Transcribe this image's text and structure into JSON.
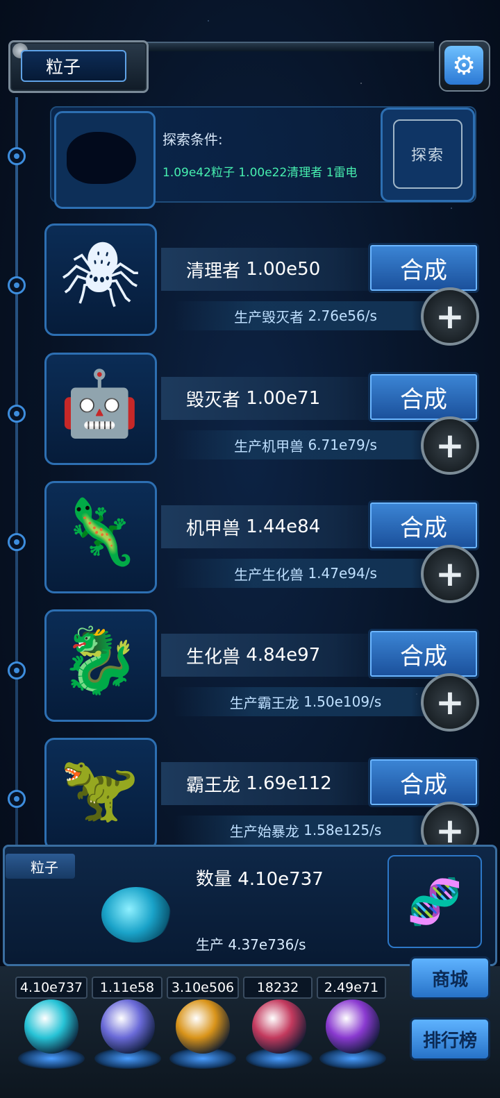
{
  "header": {
    "title": "粒子",
    "settings_icon": "gear-icon"
  },
  "explore": {
    "label": "探索条件:",
    "condition": "1.09e42粒子 1.00e22清理者 1雷电",
    "button_label": "探索",
    "button_icon": "fingerprint-icon"
  },
  "creatures": [
    {
      "name": "清理者",
      "amount": "1.00e50",
      "produces": "生产毁灭者",
      "rate": "2.76e56/s",
      "synth": "合成"
    },
    {
      "name": "毁灭者",
      "amount": "1.00e71",
      "produces": "生产机甲兽",
      "rate": "6.71e79/s",
      "synth": "合成"
    },
    {
      "name": "机甲兽",
      "amount": "1.44e84",
      "produces": "生产生化兽",
      "rate": "1.47e94/s",
      "synth": "合成"
    },
    {
      "name": "生化兽",
      "amount": "4.84e97",
      "produces": "生产霸王龙",
      "rate": "1.50e109/s",
      "synth": "合成"
    },
    {
      "name": "霸王龙",
      "amount": "1.69e112",
      "produces": "生产始暴龙",
      "rate": "1.58e125/s",
      "synth": "合成"
    }
  ],
  "particle_panel": {
    "tag": "粒子",
    "count_label": "数量",
    "count": "4.10e737",
    "prod_label": "生产",
    "prod": "4.37e736/s"
  },
  "resources": [
    {
      "value": "4.10e737",
      "icon": "particle-orb-icon",
      "color": "#27c3d6"
    },
    {
      "value": "1.11e58",
      "icon": "lightning-orb-icon",
      "color": "#6a6ad8"
    },
    {
      "value": "3.10e506",
      "icon": "fire-orb-icon",
      "color": "#d9941a"
    },
    {
      "value": "18232",
      "icon": "brain-orb-icon",
      "color": "#c33a5e"
    },
    {
      "value": "2.49e71",
      "icon": "vortex-orb-icon",
      "color": "#8a3ad0"
    }
  ],
  "side_buttons": {
    "shop": "商城",
    "ranking": "排行榜"
  }
}
